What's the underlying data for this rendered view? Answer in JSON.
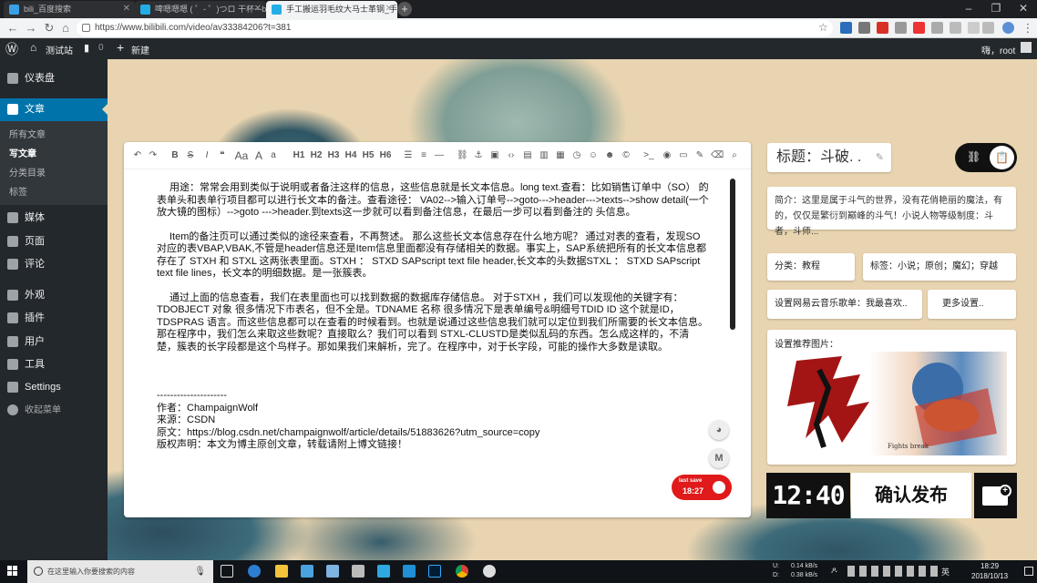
{
  "browser": {
    "tabs": [
      {
        "label": "bili_百度搜索",
        "active": false
      },
      {
        "label": "啤嗯嗯嗯 ( ゜- ゜)つロ 干杯~-bili",
        "active": false
      },
      {
        "label": "手工搬运羽毛纹大马士革钢_手绘",
        "active": true
      }
    ],
    "url": "https://www.bilibili.com/video/av33384206?t=381"
  },
  "admin_bar": {
    "site_name": "测试站",
    "comment_count": "0",
    "new_label": "新建",
    "greeting": "嗨，root"
  },
  "sidebar": {
    "items": [
      {
        "label": "仪表盘",
        "icon": "dashboard-icon"
      },
      {
        "label": "文章",
        "icon": "pin-icon",
        "current": true
      },
      {
        "label": "媒体",
        "icon": "media-icon"
      },
      {
        "label": "页面",
        "icon": "page-icon"
      },
      {
        "label": "评论",
        "icon": "comment-icon"
      },
      {
        "label": "外观",
        "icon": "brush-icon"
      },
      {
        "label": "插件",
        "icon": "plugin-icon"
      },
      {
        "label": "用户",
        "icon": "user-icon"
      },
      {
        "label": "工具",
        "icon": "wrench-icon"
      },
      {
        "label": "Settings",
        "icon": "settings-icon"
      },
      {
        "label": "收起菜单",
        "icon": "collapse-icon"
      }
    ],
    "submenu": [
      "所有文章",
      "写文章",
      "分类目录",
      "标签"
    ]
  },
  "toolbar": {
    "headings": [
      "H1",
      "H2",
      "H3",
      "H4",
      "H5",
      "H6"
    ],
    "aa": "Aa",
    "a_big": "A",
    "a_small": "a"
  },
  "editor": {
    "paragraphs": [
      "用途：常常会用到类似于说明或者备注这样的信息，这些信息就是长文本信息。long text.查看：比如销售订单中（SO） 的表单头和表单行项目都可以进行长文本的备注。查看途径： VA02-->输入订单号-->goto--->header--->texts-->show detail(一个放大镜的图标）-->goto --->header.到texts这一步就可以看到备注信息，在最后一步可以看到备注的 头信息。",
      "Item的备注页可以通过类似的途径来查看，不再赘述。 那么这些长文本信息存在什么地方呢？ 通过对表的查看，发现SO对应的表VBAP,VBAK,不管是header信息还是Item信息里面都没有存储相关的数据。事实上，SAP系统把所有的长文本信息都存在了 STXH 和 STXL 这两张表里面。STXH ： STXD SAPscript text file header,长文本的头数据STXL ： STXD SAPscript text file lines，长文本的明细数据。是一张簇表。",
      "通过上面的信息查看，我们在表里面也可以找到数据的数据库存储信息。 对于STXH ，我们可以发现他的关键字有：TDOBJECT 对象 很多情况下市表名，但不全是。TDNAME 名称 很多情况下是表单编号&明细号TDID ID 这个就是ID，TDSPRAS 语言。而这些信息都可以在查看的时候看到。也就是说通过这些信息我们就可以定位到我们所需要的长文本信息。 那在程序中，我们怎么来取这些数呢？直接取么？我们可以看到 STXL-CLUSTD是类似乱码的东西。怎么成这样的，不清楚，簇表的长字段都是这个鸟样子。那如果我们来解析，完了。在程序中，对于长字段，可能的操作大多数是读取。"
    ],
    "separator": "---------------------",
    "footer": [
      "作者：ChampaignWolf",
      "来源：CSDN",
      "原文：https://blog.csdn.net/champaignwolf/article/details/51883626?utm_source=copy",
      "版权声明：本文为博主原创文章，转载请附上博文链接！"
    ],
    "lastsave_label": "last save",
    "lastsave_time": "18:27",
    "m_label": "M"
  },
  "panel": {
    "title": "标题：斗破. .",
    "summary": "简介：这里是属于斗气的世界，没有花俏艳丽的魔法，有的，仅仅是繁衍到巅峰的斗气！小说人物等级制度：斗者，斗师...",
    "category": "分类：教程",
    "tags": "标签：小说；原创；魔幻；穿越",
    "music": "设置网易云音乐歌单：我最喜欢..",
    "more": "更多设置..",
    "image_label": "设置推荐图片：",
    "image_caption": "Fights break",
    "clock": "12:40",
    "publish": "确认发布"
  },
  "taskbar": {
    "search_placeholder": "在这里输入你要搜索的内容",
    "net_up": "0.14 kB/s",
    "net_down": "0.38 kB/s",
    "net_up_label": "U:",
    "net_down_label": "D:",
    "ime": "英",
    "time": "18:29",
    "date": "2018/10/13"
  },
  "colors": {
    "wp_blue": "#0073aa",
    "wp_dark": "#23282d",
    "save_red": "#e01a1a"
  }
}
